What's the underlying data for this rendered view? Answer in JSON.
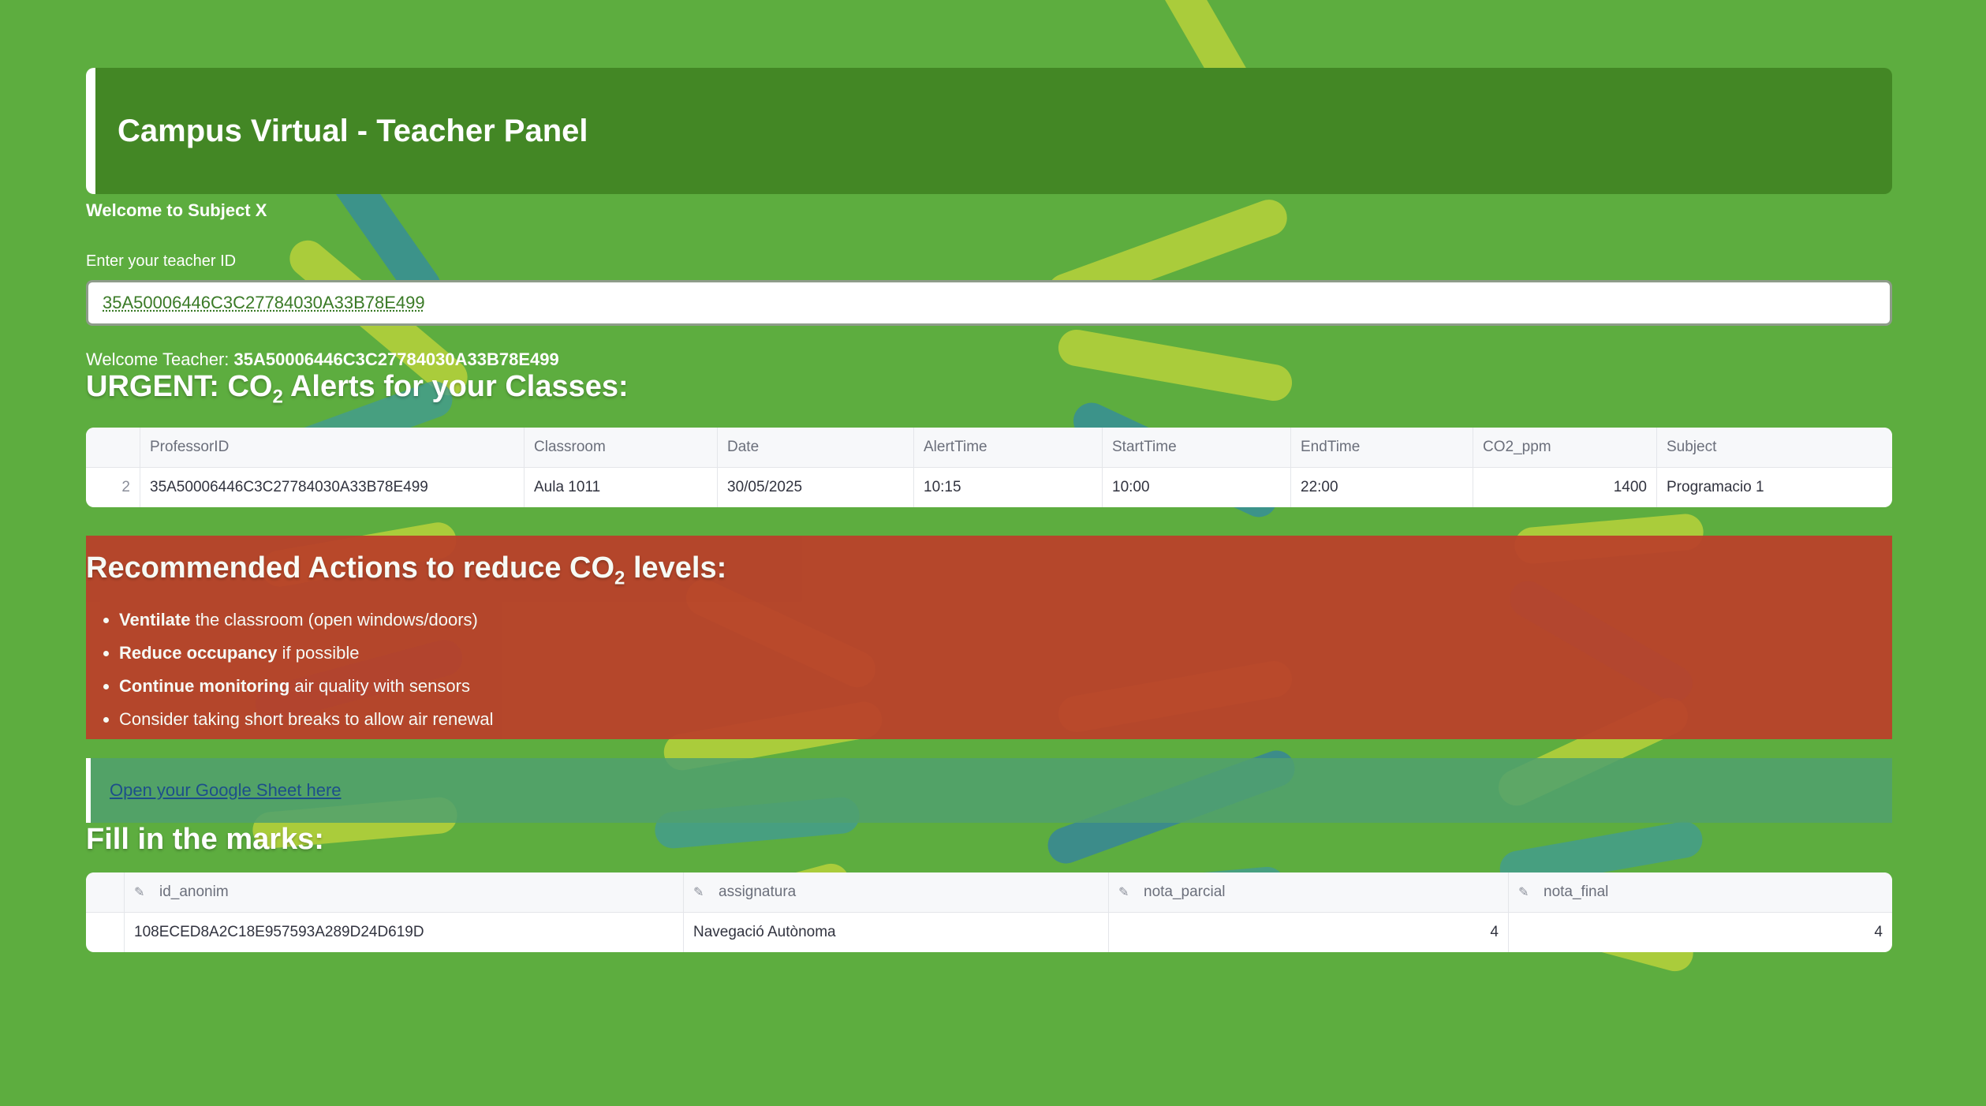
{
  "header": {
    "title": "Campus Virtual - Teacher Panel"
  },
  "welcome_subject": "Welcome to Subject X",
  "teacher_id": {
    "label": "Enter your teacher ID",
    "value": "35A50006446C3C27784030A33B78E499"
  },
  "welcome_teacher": {
    "prefix": "Welcome Teacher: ",
    "id": "35A50006446C3C27784030A33B78E499"
  },
  "alerts": {
    "title_prefix": "URGENT: CO",
    "title_sub": "2",
    "title_suffix": " Alerts for your Classes:",
    "columns": [
      "",
      "ProfessorID",
      "Classroom",
      "Date",
      "AlertTime",
      "StartTime",
      "EndTime",
      "CO2_ppm",
      "Subject"
    ],
    "rows": [
      [
        "2",
        "35A50006446C3C27784030A33B78E499",
        "Aula 1011",
        "30/05/2025",
        "10:15",
        "10:00",
        "22:00",
        "1400",
        "Programacio 1"
      ]
    ]
  },
  "actions": {
    "title_prefix": "Recommended Actions to reduce CO",
    "title_sub": "2",
    "title_suffix": " levels:",
    "items": [
      {
        "bold": "Ventilate",
        "rest": " the classroom (open windows/doors)"
      },
      {
        "bold": "Reduce occupancy",
        "rest": " if possible"
      },
      {
        "bold": "Continue monitoring",
        "rest": " air quality with sensors"
      },
      {
        "bold": "",
        "rest": "Consider taking short breaks to allow air renewal"
      }
    ]
  },
  "sheet_link": {
    "label": "Open your Google Sheet here"
  },
  "marks": {
    "title": "Fill in the marks:",
    "column_icon": "edit-column-icon",
    "columns": [
      "id_anonim",
      "assignatura",
      "nota_parcial",
      "nota_final"
    ],
    "rows": [
      [
        "108ECED8A2C18E957593A289D24D619D",
        "Navegació Autònoma",
        "4",
        "4"
      ]
    ]
  },
  "colors": {
    "background": "#5dad3f",
    "header": "#438725",
    "actions_bg": "#b9412a",
    "link": "#1d4f8a"
  }
}
